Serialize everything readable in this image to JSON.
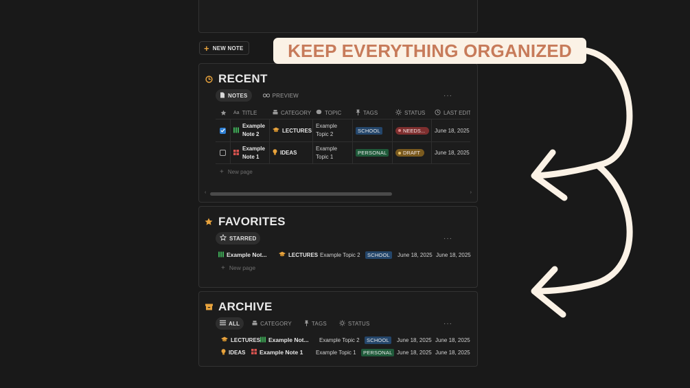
{
  "new_note_label": "NEW NOTE",
  "callout_text": "KEEP EVERYTHING ORGANIZED",
  "colors": {
    "accent": "#e8a33d",
    "callout_bg": "#fbf2e6",
    "callout_text": "#c77b5a",
    "school": "#24466b",
    "personal": "#1f5a3a",
    "needs": "#7e2f2f",
    "draft": "#7a5a1e"
  },
  "recent": {
    "title": "RECENT",
    "tabs": [
      {
        "label": "NOTES",
        "icon": "document-icon"
      },
      {
        "label": "PREVIEW",
        "icon": "binoculars-icon"
      }
    ],
    "more": "···",
    "columns": {
      "title": "TITLE",
      "category": "CATEGORY",
      "topic": "TOPIC",
      "tags": "TAGS",
      "status": "STATUS",
      "last_edited": "LAST EDITE"
    },
    "rows": [
      {
        "checked": true,
        "title": "Example Note 2",
        "category": "LECTURES",
        "topic": "Example Topic 2",
        "tag": "SCHOOL",
        "status": "NEEDS...",
        "date": "June 18, 2025"
      },
      {
        "checked": false,
        "title": "Example Note 1",
        "category": "IDEAS",
        "topic": "Example Topic 1",
        "tag": "PERSONAL",
        "status": "DRAFT",
        "date": "June 18, 2025"
      }
    ],
    "new_page": "New page"
  },
  "favorites": {
    "title": "FAVORITES",
    "tabs": [
      {
        "label": "STARRED",
        "icon": "star-outline-icon"
      }
    ],
    "more": "···",
    "row": {
      "title": "Example Not...",
      "category": "LECTURES",
      "topic": "Example Topic 2",
      "tag": "SCHOOL",
      "date1": "June 18, 2025",
      "date2": "June 18, 2025"
    },
    "new_page": "New page"
  },
  "archive": {
    "title": "ARCHIVE",
    "tabs": [
      {
        "label": "ALL",
        "icon": "list-icon"
      },
      {
        "label": "CATEGORY",
        "icon": "stack-icon"
      },
      {
        "label": "TAGS",
        "icon": "pin-icon"
      },
      {
        "label": "STATUS",
        "icon": "sun-icon"
      }
    ],
    "more": "···",
    "rows": [
      {
        "category": "LECTURES",
        "title": "Example Not...",
        "topic": "Example Topic 2",
        "tag": "SCHOOL",
        "date1": "June 18, 2025",
        "date2": "June 18, 2025"
      },
      {
        "category": "IDEAS",
        "title": "Example Note 1",
        "topic": "Example Topic 1",
        "tag": "PERSONAL",
        "date1": "June 18, 2025",
        "date2": "June 18, 2025"
      }
    ]
  }
}
